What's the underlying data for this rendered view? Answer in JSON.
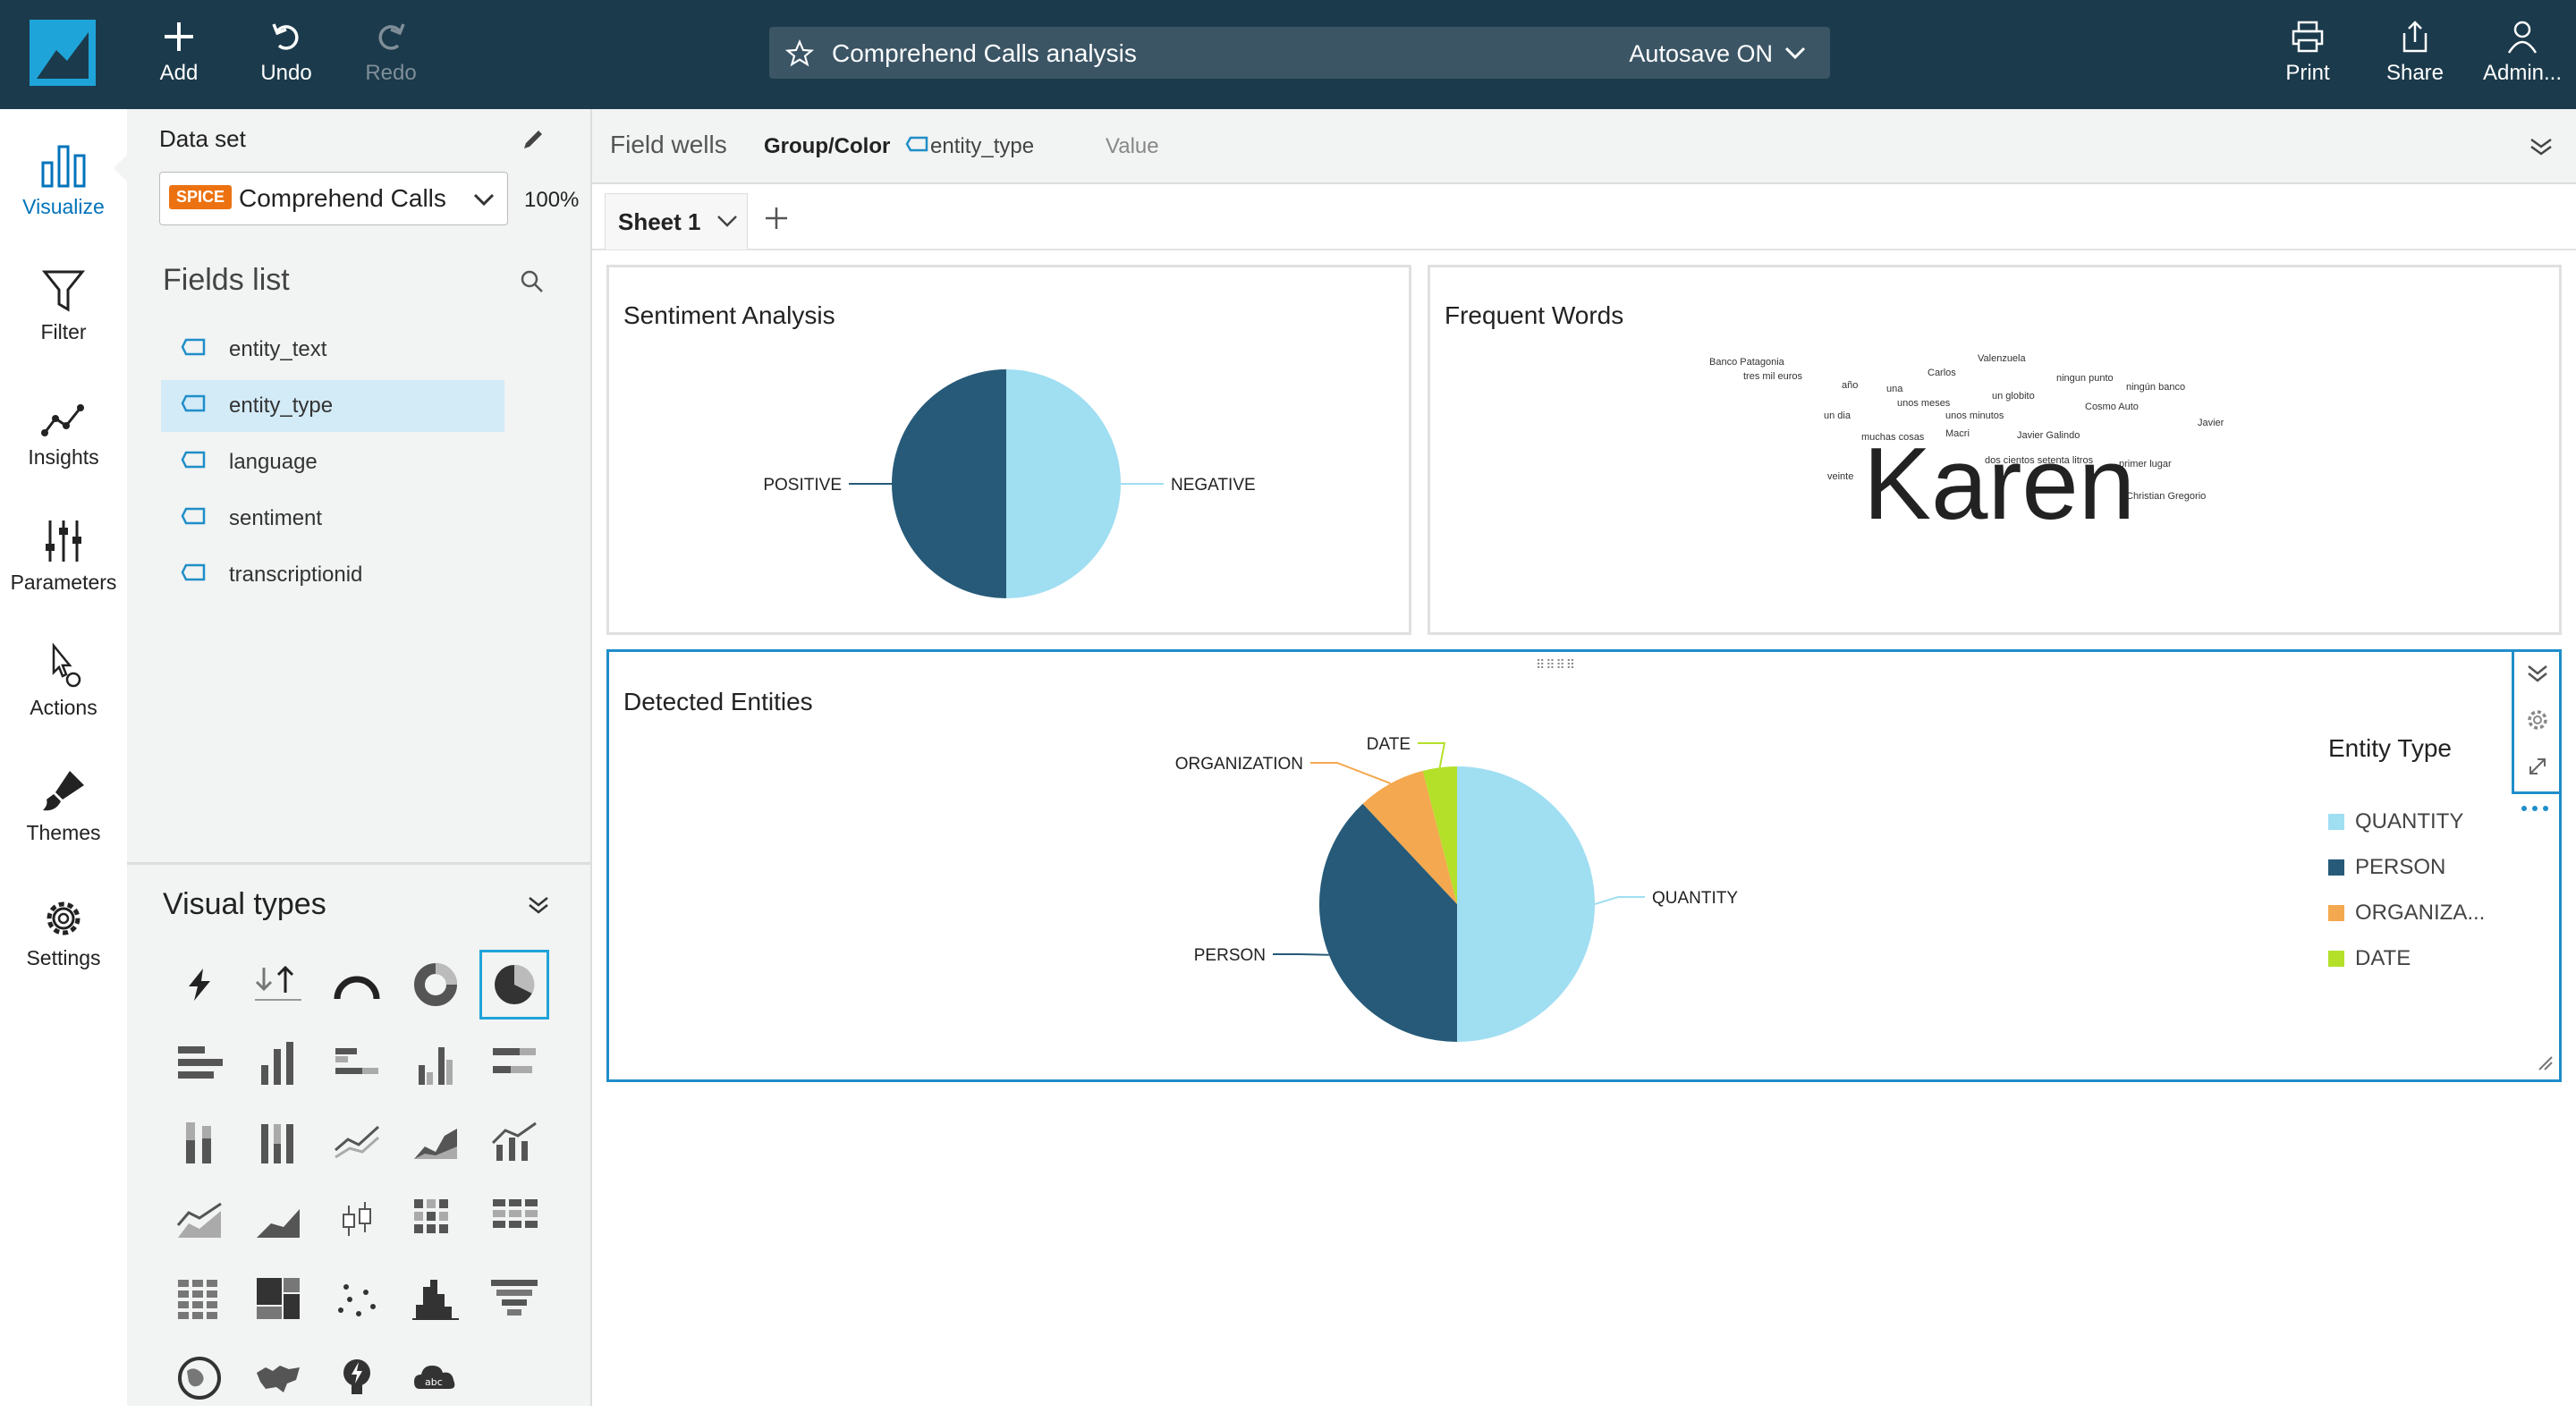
{
  "topbar": {
    "add_label": "Add",
    "undo_label": "Undo",
    "redo_label": "Redo",
    "analysis_title": "Comprehend Calls analysis",
    "autosave_label": "Autosave ON",
    "print_label": "Print",
    "share_label": "Share",
    "user_label": "Admin..."
  },
  "leftnav": {
    "visualize": "Visualize",
    "filter": "Filter",
    "insights": "Insights",
    "parameters": "Parameters",
    "actions": "Actions",
    "themes": "Themes",
    "settings": "Settings"
  },
  "dataset": {
    "label": "Data set",
    "badge": "SPICE",
    "name": "Comprehend Calls",
    "percent": "100%"
  },
  "fields": {
    "title": "Fields list",
    "items": [
      "entity_text",
      "entity_type",
      "language",
      "sentiment",
      "transcriptionid"
    ],
    "selected": "entity_type"
  },
  "visual_types": {
    "title": "Visual types"
  },
  "fieldwells": {
    "label": "Field wells",
    "group_color_label": "Group/Color",
    "group_color_value": "entity_type",
    "value_label": "Value"
  },
  "sheet": {
    "tab_label": "Sheet 1"
  },
  "visuals": {
    "sentiment_title": "Sentiment Analysis",
    "words_title": "Frequent Words",
    "entities_title": "Detected Entities",
    "legend_title": "Entity Type"
  },
  "word_cloud": {
    "main_word": "Karen",
    "words": [
      "Banco Patagonia",
      "tres mil euros",
      "año",
      "una",
      "Carlos",
      "Valenzuela",
      "ningun punto",
      "unos meses",
      "un globito",
      "ningún banco",
      "Cosmo Auto",
      "un dia",
      "unos minutos",
      "Javier",
      "muchas cosas",
      "Macri",
      "Javier Galindo",
      "dos cientos setenta litros",
      "primer lugar",
      "veinte",
      "Christian Gregorio"
    ]
  },
  "chart_data": [
    {
      "type": "pie",
      "title": "Sentiment Analysis",
      "categories": [
        "NEGATIVE",
        "POSITIVE"
      ],
      "values": [
        50,
        50
      ],
      "colors": [
        "#a0def2",
        "#265a78"
      ]
    },
    {
      "type": "pie",
      "title": "Detected Entities",
      "legend_title": "Entity Type",
      "categories": [
        "QUANTITY",
        "PERSON",
        "ORGANIZATION",
        "DATE"
      ],
      "legend_labels": [
        "QUANTITY",
        "PERSON",
        "ORGANIZA...",
        "DATE"
      ],
      "values": [
        50,
        38,
        8,
        4
      ],
      "colors": [
        "#a0def2",
        "#265a78",
        "#f4a84f",
        "#b4e02a"
      ],
      "legend_position": "right"
    }
  ]
}
